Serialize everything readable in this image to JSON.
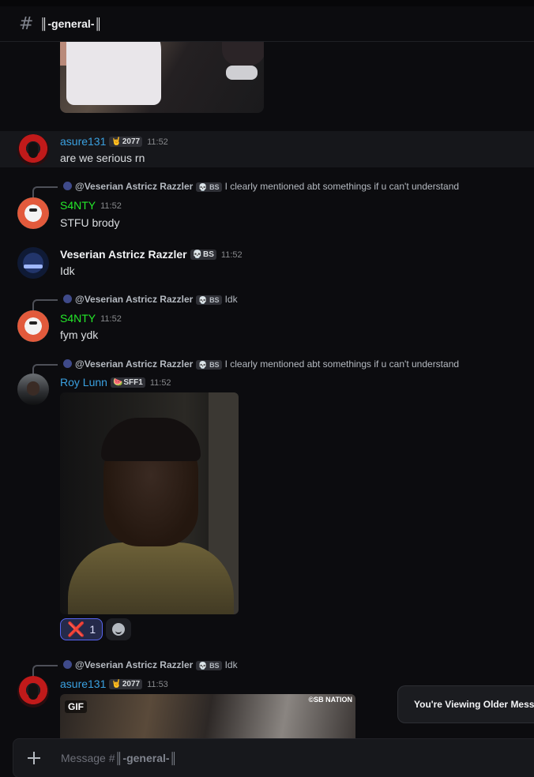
{
  "channel": {
    "hash": "#",
    "name": "║-general-║"
  },
  "messages": [
    {
      "author": "asure131",
      "tag_icon": "🤘",
      "tag": "2077",
      "time": "11:52",
      "text": "are we serious rn"
    },
    {
      "reply_to": {
        "author": "@Veserian Astricz Razzler",
        "tag_icon": "💀",
        "tag": "BS",
        "text": "I clearly mentioned abt somethings if u can't understand"
      },
      "author": "S4NTY",
      "time": "11:52",
      "text": "STFU brody"
    },
    {
      "author": "Veserian Astricz Razzler",
      "tag_icon": "💀",
      "tag": "BS",
      "time": "11:52",
      "text": "Idk"
    },
    {
      "reply_to": {
        "author": "@Veserian Astricz Razzler",
        "tag_icon": "💀",
        "tag": "BS",
        "text": "Idk"
      },
      "author": "S4NTY",
      "time": "11:52",
      "text": "fym ydk"
    },
    {
      "reply_to": {
        "author": "@Veserian Astricz Razzler",
        "tag_icon": "💀",
        "tag": "BS",
        "text": "I clearly mentioned abt somethings if u can't understand"
      },
      "author": "Roy Lunn",
      "tag_icon": "🍉",
      "tag": "SFF1",
      "time": "11:52",
      "reactions": [
        {
          "emoji": "❌",
          "count": "1"
        }
      ]
    },
    {
      "reply_to": {
        "author": "@Veserian Astricz Razzler",
        "tag_icon": "💀",
        "tag": "BS",
        "text": "Idk"
      },
      "author": "asure131",
      "tag_icon": "🤘",
      "tag": "2077",
      "time": "11:53",
      "gif_label": "GIF",
      "gif_watermark": "©SB NATION"
    }
  ],
  "toast": "You're Viewing Older Messa",
  "composer": {
    "placeholder_prefix": "Message #",
    "placeholder_channel": "║-general-║"
  }
}
